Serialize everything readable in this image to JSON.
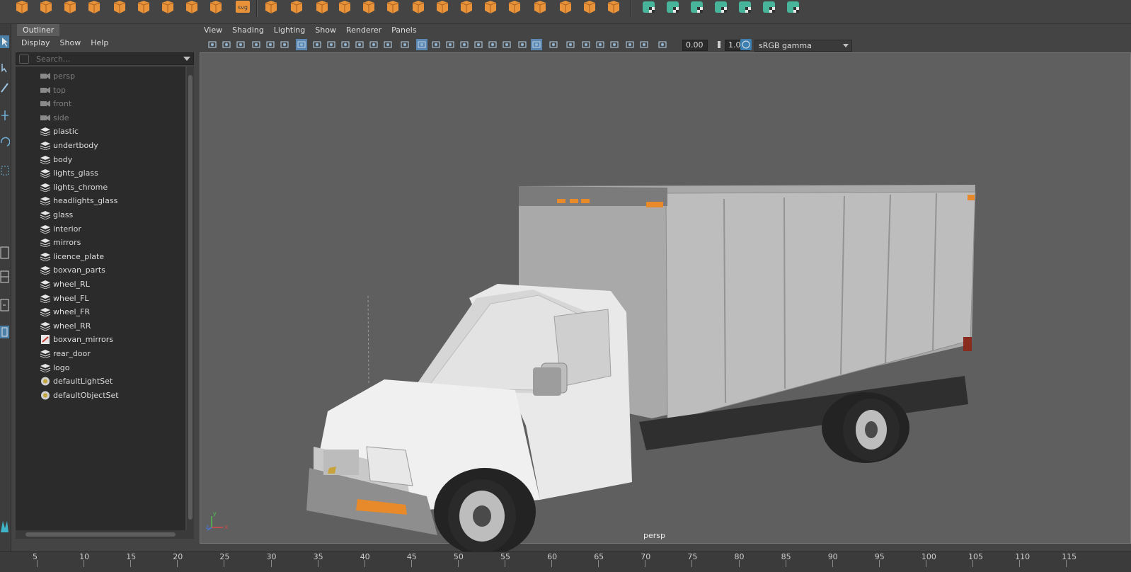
{
  "outliner": {
    "tab_label": "Outliner",
    "menu": [
      "Display",
      "Show",
      "Help"
    ],
    "search_placeholder": "Search...",
    "items": [
      {
        "label": "persp",
        "type": "camera",
        "dim": true
      },
      {
        "label": "top",
        "type": "camera",
        "dim": true
      },
      {
        "label": "front",
        "type": "camera",
        "dim": true
      },
      {
        "label": "side",
        "type": "camera",
        "dim": true
      },
      {
        "label": "plastic",
        "type": "group",
        "dim": false
      },
      {
        "label": "undertbody",
        "type": "group",
        "dim": false
      },
      {
        "label": "body",
        "type": "group",
        "dim": false
      },
      {
        "label": "lights_glass",
        "type": "group",
        "dim": false
      },
      {
        "label": "lights_chrome",
        "type": "group",
        "dim": false
      },
      {
        "label": "headlights_glass",
        "type": "group",
        "dim": false
      },
      {
        "label": "glass",
        "type": "group",
        "dim": false
      },
      {
        "label": "interior",
        "type": "group",
        "dim": false
      },
      {
        "label": "mirrors",
        "type": "group",
        "dim": false
      },
      {
        "label": "licence_plate",
        "type": "group",
        "dim": false
      },
      {
        "label": "boxvan_parts",
        "type": "group",
        "dim": false
      },
      {
        "label": "wheel_RL",
        "type": "group",
        "dim": false
      },
      {
        "label": "wheel_FL",
        "type": "group",
        "dim": false
      },
      {
        "label": "wheel_FR",
        "type": "group",
        "dim": false
      },
      {
        "label": "wheel_RR",
        "type": "group",
        "dim": false
      },
      {
        "label": "boxvan_mirrors",
        "type": "mesh",
        "dim": false
      },
      {
        "label": "rear_door",
        "type": "group",
        "dim": false
      },
      {
        "label": "logo",
        "type": "group",
        "dim": false
      },
      {
        "label": "defaultLightSet",
        "type": "set",
        "dim": false
      },
      {
        "label": "defaultObjectSet",
        "type": "set",
        "dim": false
      }
    ]
  },
  "viewport": {
    "menu": [
      "View",
      "Shading",
      "Lighting",
      "Show",
      "Renderer",
      "Panels"
    ],
    "exposure": "0.00",
    "gamma": "1.00",
    "colorspace": "sRGB gamma",
    "camera_label": "persp",
    "axis_labels": {
      "x": "x",
      "y": "y",
      "z": "z"
    }
  },
  "shelf": {
    "svg_label": "svg"
  },
  "timeline": {
    "ticks": [
      "5",
      "10",
      "15",
      "20",
      "25",
      "30",
      "35",
      "40",
      "45",
      "50",
      "55",
      "60",
      "65",
      "70",
      "75",
      "80",
      "85",
      "90",
      "95",
      "100",
      "105",
      "110",
      "115"
    ]
  },
  "colors": {
    "accent_orange": "#e8923a",
    "accent_green": "#48b59a",
    "viewport_bg": "#5f5f5f",
    "panel_bg": "#444444",
    "list_bg": "#2b2b2b"
  }
}
